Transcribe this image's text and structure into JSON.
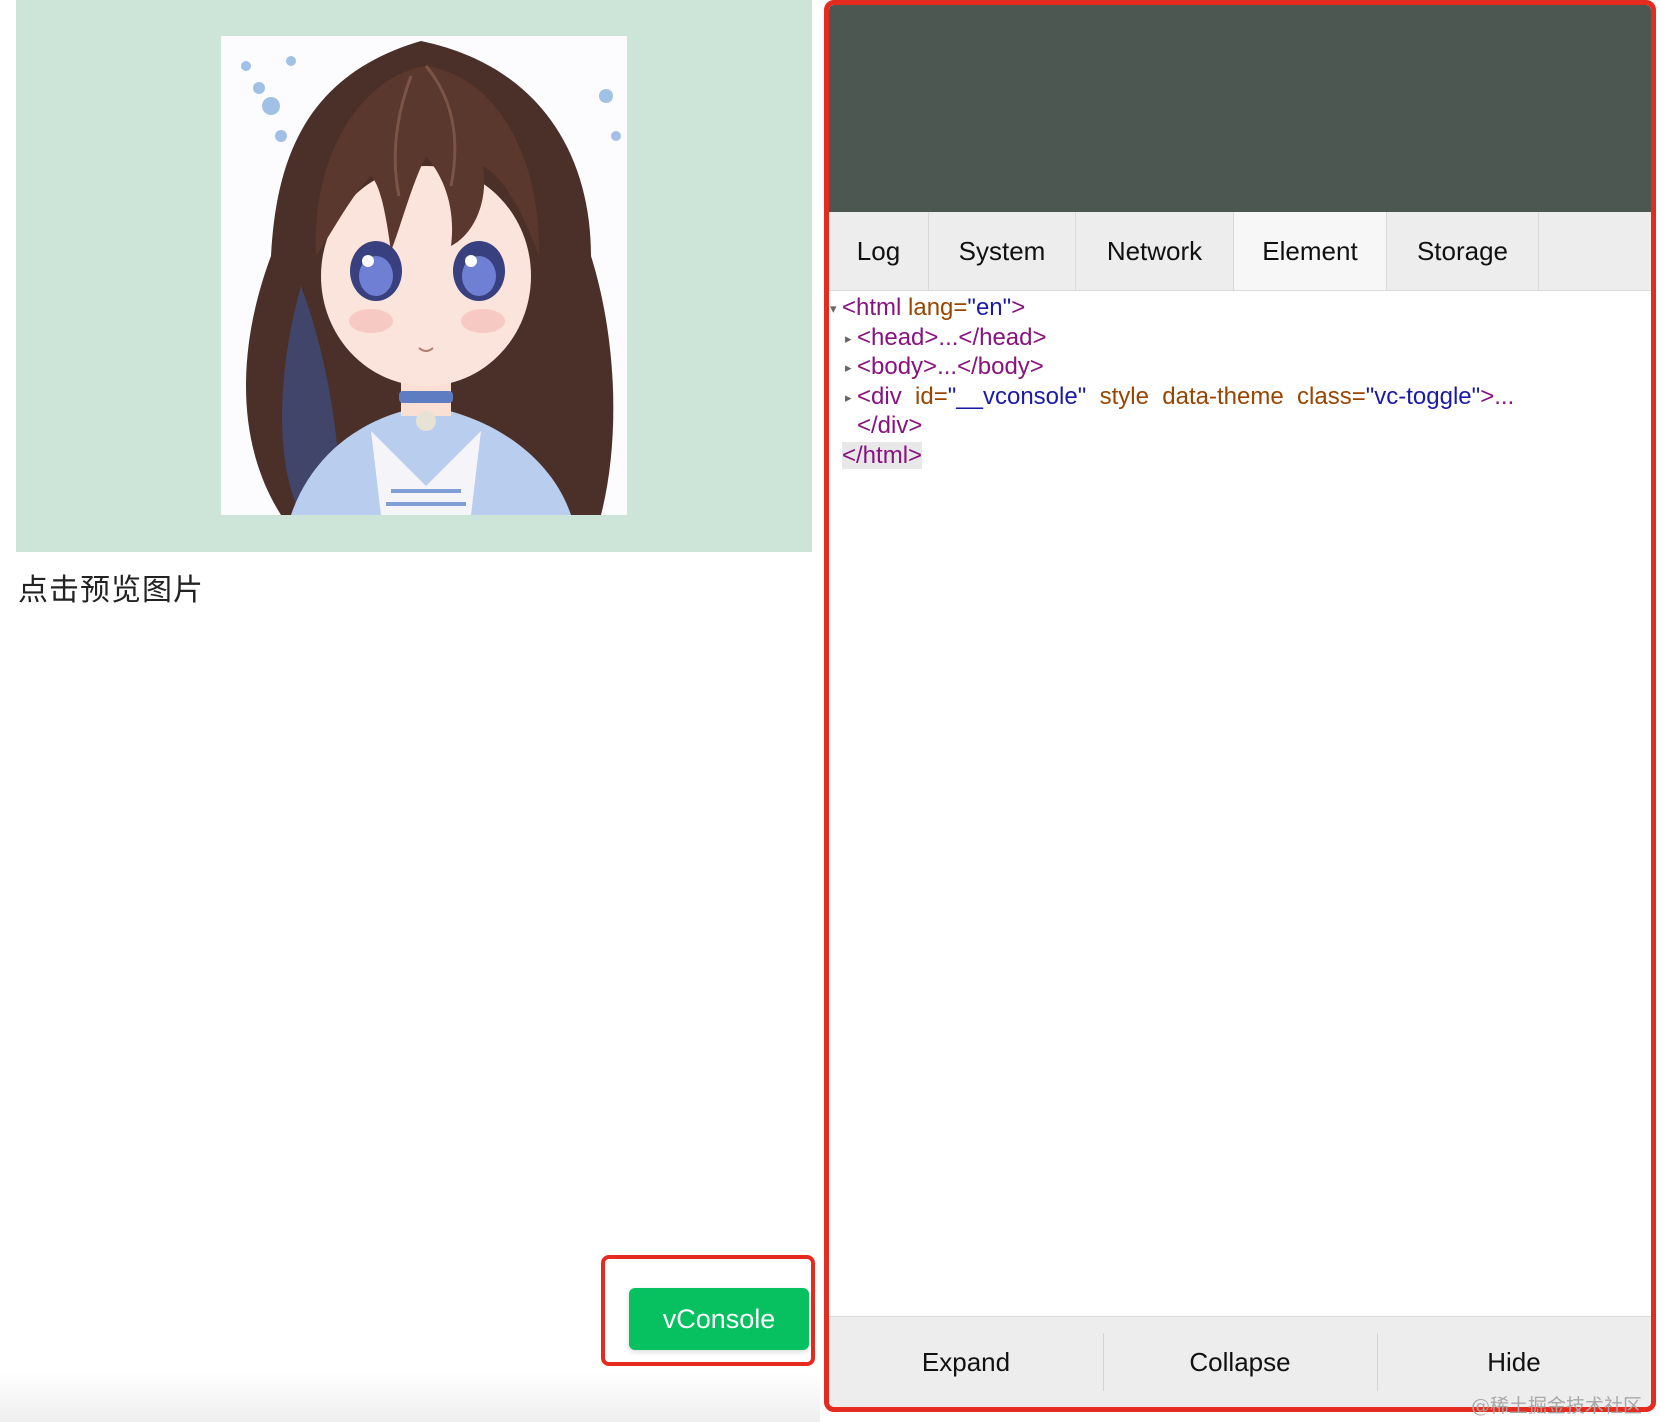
{
  "page": {
    "caption": "点击预览图片",
    "vconsole_button": "vConsole"
  },
  "vconsole": {
    "tabs": [
      {
        "label": "Log",
        "active": false
      },
      {
        "label": "System",
        "active": false
      },
      {
        "label": "Network",
        "active": false
      },
      {
        "label": "Element",
        "active": true
      },
      {
        "label": "Storage",
        "active": false
      }
    ],
    "element_tree": {
      "html_open": {
        "tag": "<html",
        "attr_name": "lang",
        "attr_value": "en",
        "close": ">"
      },
      "head": "<head>...</head>",
      "body": "<body>...</body>",
      "div_open": {
        "tag": "<div",
        "id_name": "id",
        "id_value": "__vconsole",
        "flag1": "style",
        "flag2": "data-theme",
        "class_name": "class",
        "class_value": "vc-toggle",
        "tail": ">..."
      },
      "div_close": "</div>",
      "html_close": "</html>"
    },
    "toolbar": {
      "expand": "Expand",
      "collapse": "Collapse",
      "hide": "Hide"
    }
  },
  "watermark": "@稀土掘金技术社区",
  "colors": {
    "preview_bg": "#cde5d8",
    "button_green": "#07c160",
    "highlight_red": "#e52b1f",
    "mask": "#4d5752",
    "tag": "#881280",
    "attr": "#994500",
    "value": "#1a1aa6"
  }
}
